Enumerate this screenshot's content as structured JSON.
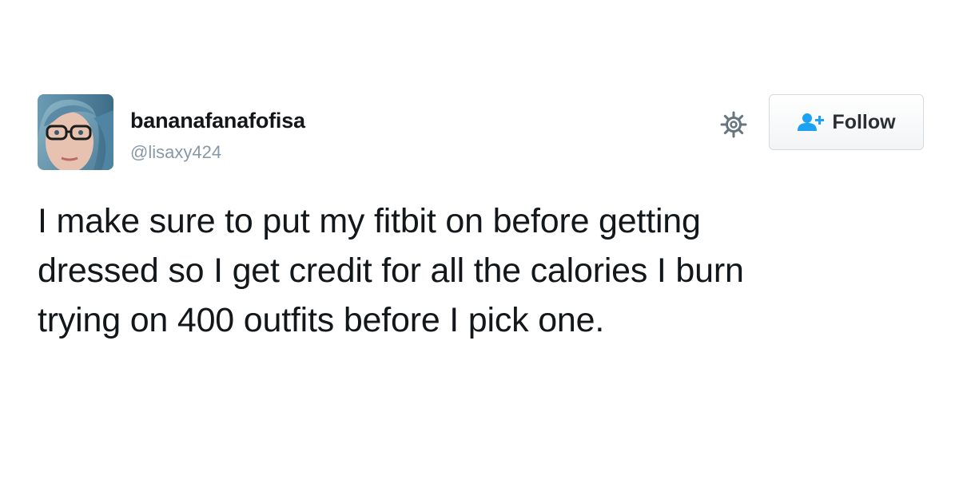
{
  "tweet": {
    "display_name": "bananafanafofisa",
    "handle": "@lisaxy424",
    "text_lines": [
      "I make sure to put my fitbit on before getting",
      "dressed so I get credit for all the calories I burn",
      "trying on 400 outfits before I pick one."
    ]
  },
  "actions": {
    "follow_label": "Follow",
    "follow_icon": "add-user-icon",
    "settings_icon": "gear-icon"
  },
  "colors": {
    "text": "#14171a",
    "handle": "#8899a6",
    "follow_icon": "#1da1f2",
    "gear": "#66757f"
  }
}
